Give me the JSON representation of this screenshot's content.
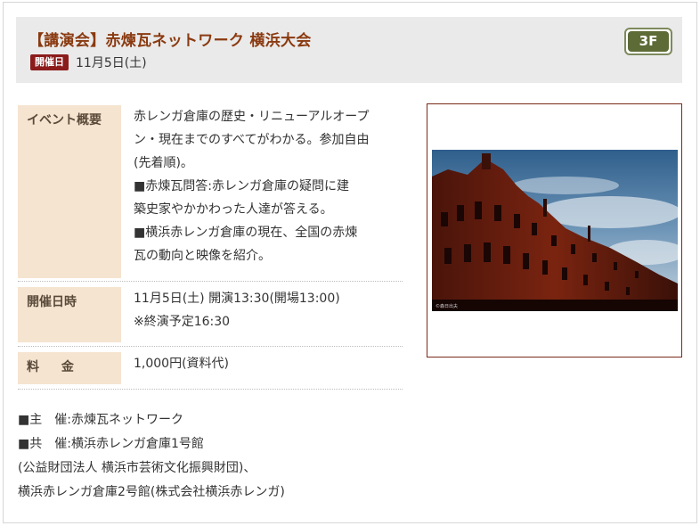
{
  "event": {
    "title": "【講演会】赤煉瓦ネットワーク 横浜大会",
    "date_badge": "開催日",
    "date": "11月5日(土)",
    "floor": "3F"
  },
  "details": {
    "overview_label": "イベント概要",
    "overview_lines": [
      "赤レンガ倉庫の歴史・リニューアルオープ",
      "ン・現在までのすべてがわかる。参加自由",
      "(先着順)。",
      "■赤煉瓦問答:赤レンガ倉庫の疑問に建",
      "築史家やかかわった人達が答える。",
      "■横浜赤レンガ倉庫の現在、全国の赤煉",
      "瓦の動向と映像を紹介。"
    ],
    "datetime_label": "開催日時",
    "datetime_lines": [
      "11月5日(土) 開演13:30(開場13:00)",
      "※終演予定16:30"
    ],
    "fee_label": "料 金",
    "fee": "1,000円(資料代)"
  },
  "sponsors": [
    "■主　催:赤煉瓦ネットワーク",
    "■共　催:横浜赤レンガ倉庫1号館",
    "(公益財団法人 横浜市芸術文化振興財団)、",
    "横浜赤レンガ倉庫2号館(株式会社横浜赤レンガ)"
  ],
  "photo": {
    "subject": "red-brick-warehouse-photo",
    "credit": "©森日出夫"
  },
  "colors": {
    "title": "#8a3a10",
    "date_badge_bg": "#8b1c1c",
    "floor_badge": "#5d6b36",
    "label_bg": "#f5e4d0",
    "header_bg": "#eaeaea"
  }
}
